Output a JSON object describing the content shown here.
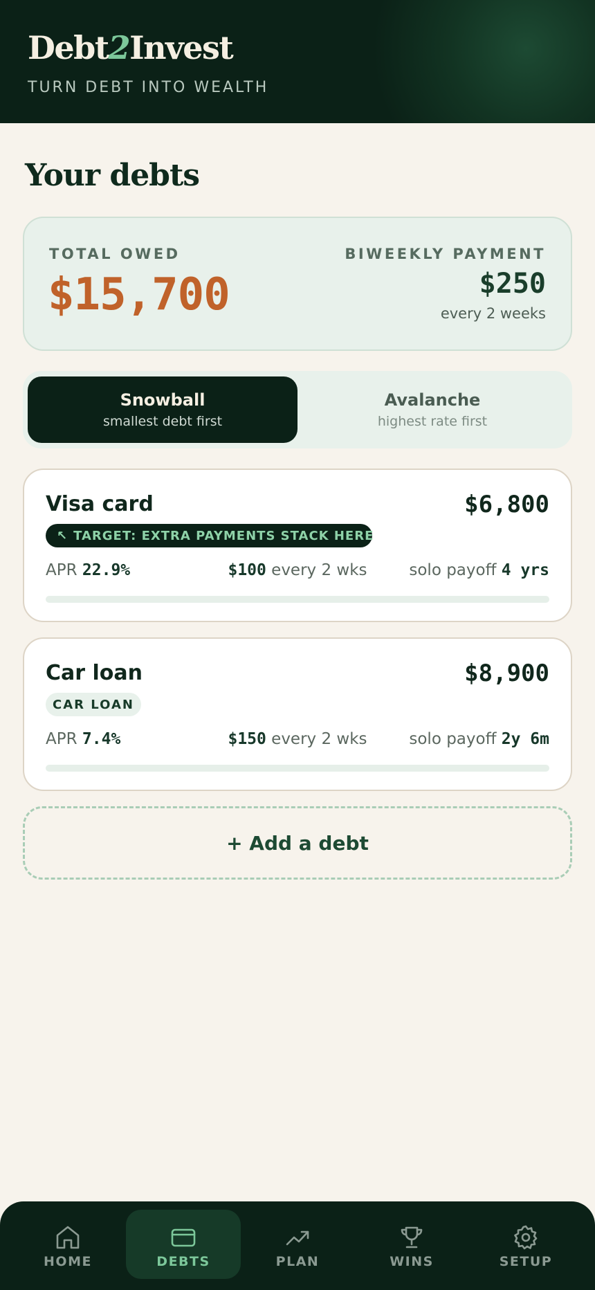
{
  "app": {
    "logo_part1": "Debt",
    "logo_accent": "2",
    "logo_part2": "Invest",
    "tagline": "TURN DEBT INTO WEALTH"
  },
  "page_title": "Your debts",
  "summary": {
    "total_label": "TOTAL OWED",
    "total_value": "$15,700",
    "payment_label": "BIWEEKLY PAYMENT",
    "payment_value": "$250",
    "payment_frequency": "every 2 weeks"
  },
  "strategy": {
    "selected": "Snowball",
    "options": [
      {
        "title": "Snowball",
        "subtitle": "smallest debt first"
      },
      {
        "title": "Avalanche",
        "subtitle": "highest rate first"
      }
    ]
  },
  "debts": [
    {
      "name": "Visa card",
      "amount": "$6,800",
      "badge": "TARGET: EXTRA PAYMENTS STACK HERE",
      "badge_icon": "arrow-up-left-icon",
      "apr_label": "APR",
      "apr": "22.9%",
      "payment": "$100",
      "payment_suffix": "every 2 wks",
      "payoff_label": "solo payoff",
      "payoff": "4 yrs",
      "progress": 0
    },
    {
      "name": "Car loan",
      "amount": "$8,900",
      "badge": "CAR LOAN",
      "apr_label": "APR",
      "apr": "7.4%",
      "payment": "$150",
      "payment_suffix": "every 2 wks",
      "payoff_label": "solo payoff",
      "payoff": "2y 6m",
      "progress": 0
    }
  ],
  "add_debt_label": "+ Add a debt",
  "nav": {
    "active": "DEBTS",
    "items": [
      {
        "label": "HOME",
        "icon": "home-icon"
      },
      {
        "label": "DEBTS",
        "icon": "credit-card-icon"
      },
      {
        "label": "PLAN",
        "icon": "trending-up-icon"
      },
      {
        "label": "WINS",
        "icon": "trophy-icon"
      },
      {
        "label": "SETUP",
        "icon": "gear-icon"
      }
    ]
  },
  "colors": {
    "header_bg": "#0b2117",
    "accent_green": "#7cc79a",
    "total_orange": "#c0622a",
    "page_bg": "#f7f3ec"
  }
}
